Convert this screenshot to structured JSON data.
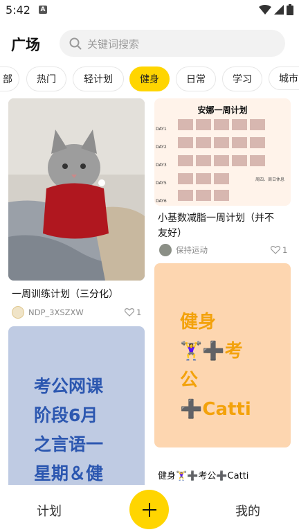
{
  "status": {
    "time": "5:42",
    "notif_letter": "A"
  },
  "header": {
    "title": "广场",
    "search_placeholder": "关键词搜索"
  },
  "tabs": [
    {
      "label": "部"
    },
    {
      "label": "热门"
    },
    {
      "label": "轻计划"
    },
    {
      "label": "健身",
      "active": true
    },
    {
      "label": "日常"
    },
    {
      "label": "学习"
    },
    {
      "label": "城市"
    }
  ],
  "cards": {
    "cat": {
      "title": "一周训练计划（三分化）",
      "user": "NDP_3XSZXW",
      "likes": "1"
    },
    "plan": {
      "image_title": "安娜一周计划",
      "days": [
        "DAY1",
        "DAY2",
        "DAY3",
        "DAY5",
        "DAY6"
      ],
      "footer": "周四、周日休息",
      "title_line1": "小基数减脂一周计划（并不",
      "title_line2": "友好）",
      "user": "保持运动",
      "likes": "1"
    },
    "exam": {
      "line1": "考公网课",
      "line2": "阶段6月",
      "line3": "之言语一",
      "line4": "星期＆健"
    },
    "fit": {
      "line1": "健身",
      "line2": "🏋️‍♀️➕考",
      "line3": "公",
      "line4": "➕Catti",
      "title": "健身🏋️‍♀️➕考公➕Catti"
    }
  },
  "nav": {
    "left": "计划",
    "right": "我的"
  },
  "colors": {
    "accent": "#ffd500",
    "peach": "#fdd6b0",
    "blue_card": "#bfcbe3",
    "blue_text": "#2c57b0"
  }
}
